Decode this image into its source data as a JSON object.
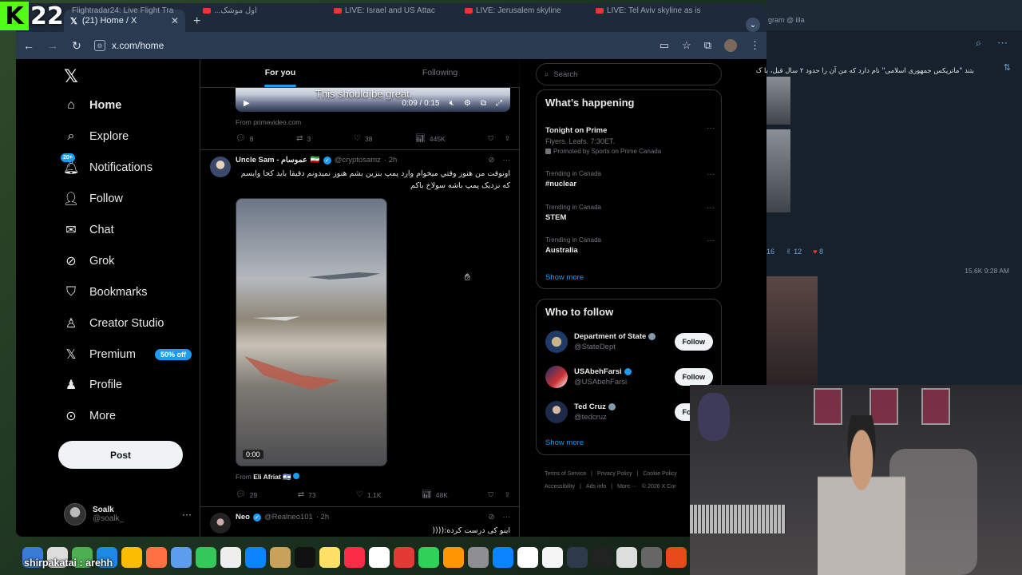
{
  "stream": {
    "logo_letter": "K",
    "logo_number": "22",
    "chat_user": "shirpakatai",
    "chat_message": "arehh"
  },
  "browser": {
    "ghost_tabs": [
      "Flightradar24: Live Flight Tra",
      "...ﺍﻭﻝ ﻣﻮﺷﮏ",
      "LIVE: Israel and US Attac",
      "LIVE: Jerusalem skyline",
      "LIVE: Tel Aviv skyline as is"
    ],
    "active_tab": "(21) Home / X",
    "url": "x.com/home"
  },
  "nav": {
    "items": [
      {
        "label": "Home",
        "icon": "home-icon"
      },
      {
        "label": "Explore",
        "icon": "search-icon"
      },
      {
        "label": "Notifications",
        "icon": "bell-icon",
        "badge": "20+"
      },
      {
        "label": "Follow",
        "icon": "add-user-icon"
      },
      {
        "label": "Chat",
        "icon": "mail-icon"
      },
      {
        "label": "Grok",
        "icon": "grok-icon"
      },
      {
        "label": "Bookmarks",
        "icon": "bookmark-icon"
      },
      {
        "label": "Creator Studio",
        "icon": "creator-icon"
      },
      {
        "label": "Premium",
        "icon": "x-icon",
        "pill": "50% off"
      },
      {
        "label": "Profile",
        "icon": "profile-icon"
      },
      {
        "label": "More",
        "icon": "more-icon"
      }
    ],
    "post_label": "Post",
    "account": {
      "name": "Soalk",
      "handle": "@soalk_"
    }
  },
  "timeline": {
    "tabs": [
      "For you",
      "Following"
    ],
    "video_caption": "This should be great.",
    "video_time": "0:09 / 0:15",
    "tweet1": {
      "from": "From primevideo.com",
      "replies": "8",
      "reposts": "3",
      "likes": "38",
      "views": "445K"
    },
    "tweet2": {
      "name": "Uncle Sam - ﻋﻤﻮﺳﺎﻡ",
      "handle": "@cryptosamz",
      "time": "· 2h",
      "text": "اونوقت من هنوز وقتي میخوام وارد پمپ بنزین بشم هنوز نمیدونم دقیقا باید کجا وایسم که نزدیک پمپ باشه سولاخ باکم",
      "duration": "0:00",
      "from_prefix": "From",
      "from_name": "Eli Afriat 🇮🇱",
      "replies": "29",
      "reposts": "73",
      "likes": "1.1K",
      "views": "48K"
    },
    "tweet3": {
      "name": "Neo",
      "handle": "@Realneo101",
      "time": "· 2h",
      "text": "اینو کی درست کرده:(((("
    }
  },
  "right": {
    "search_placeholder": "Search",
    "happening_title": "What’s happening",
    "trends": [
      {
        "meta": "",
        "title": "Tonight on Prime",
        "sub": "Flyers. Leafs. 7:30ET.",
        "promo": "Promoted by Sports on Prime Canada"
      },
      {
        "meta": "Trending in Canada",
        "title": "#nuclear"
      },
      {
        "meta": "Trending in Canada",
        "title": "STEM"
      },
      {
        "meta": "Trending in Canada",
        "title": "Australia"
      }
    ],
    "show_more": "Show more",
    "wtf_title": "Who to follow",
    "who_to_follow": [
      {
        "name": "Department of State",
        "handle": "@StateDept"
      },
      {
        "name": "USAbehFarsi",
        "handle": "@USAbehFarsi"
      },
      {
        "name": "Ted Cruz",
        "handle": "@tedcruz"
      }
    ],
    "follow_label": "Follow",
    "footer": [
      "Terms of Service",
      "|",
      "Privacy Policy",
      "|",
      "Cookie Policy",
      "Accessibility",
      "|",
      "Ads info",
      "|",
      "More ···",
      "© 2026 X Cor"
    ]
  },
  "sidepanel": {
    "header": "gram @ illa",
    "message": "بتند \"ماتریکس جمهوری اسلامی\" نام دارد که من آن را حدود ۲ سال قبل، با ک",
    "reactions": [
      "16",
      "12",
      "8"
    ],
    "views": "15.6K 9:28 AM"
  },
  "colors": {
    "accent": "#1d9bf0",
    "bg": "#000000",
    "kick": "#53fc18"
  }
}
